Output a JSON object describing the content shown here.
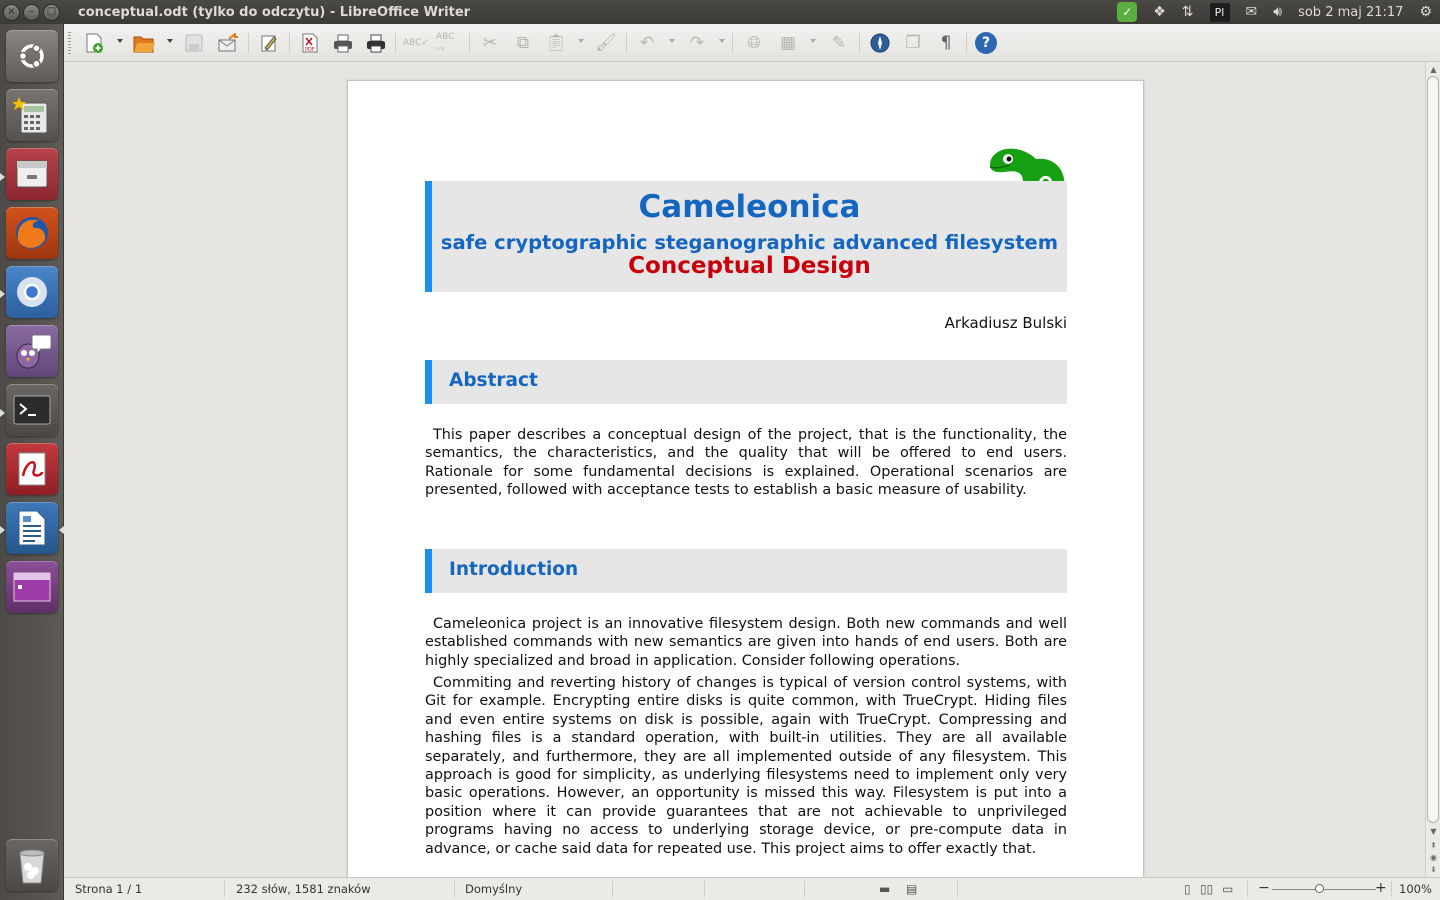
{
  "window": {
    "title": "conceptual.odt (tylko do odczytu) - LibreOffice Writer",
    "close": "×",
    "minimize": "–",
    "maximize": "□"
  },
  "indicators": {
    "keyboard_layout": "Pl",
    "clock": "sob  2 maj 21:17",
    "icons": [
      "update-icon",
      "dropbox-icon",
      "network-icon",
      "keyboard-layout-icon",
      "mail-icon",
      "volume-icon",
      "gear-icon"
    ]
  },
  "launcher": {
    "items": [
      "Ubuntu Dash",
      "Calculator",
      "Files",
      "Firefox",
      "Chromium",
      "Pidgin",
      "Terminal",
      "Document Viewer",
      "LibreOffice Writer",
      "Workspaces",
      "Trash"
    ]
  },
  "toolbar": {
    "pdf_label": "PDF",
    "pilcrow": "¶",
    "help": "?"
  },
  "document": {
    "title": "Cameleonica",
    "subtitle": "safe cryptographic steganographic advanced filesystem",
    "kind": "Conceptual Design",
    "author": "Arkadiusz Bulski",
    "sections": [
      {
        "heading": "Abstract",
        "paragraphs": [
          "This paper describes a conceptual design of the project, that is the functionality, the semantics, the characteristics, and the quality that will be offered to end users. Rationale for some fundamental decisions is explained. Operational scenarios are presented, followed with acceptance tests to establish a basic measure of usability."
        ]
      },
      {
        "heading": "Introduction",
        "paragraphs": [
          "Cameleonica project is an innovative filesystem design. Both new commands and well established commands with new semantics are given into hands of end users. Both are highly specialized and broad in application. Consider following operations.",
          "Commiting and reverting history of changes is typical of version control systems, with Git for example. Encrypting entire disks is quite common, with TrueCrypt. Hiding files and even entire systems on disk is possible, again with TrueCrypt. Compressing and hashing files is a standard operation, with built-in utilities. They are all available separately, and furthermore, they are all implemented outside of any filesystem. This approach is good for simplicity, as underlying filesystems need to implement only very basic operations. However, an opportunity is missed this way. Filesystem is put into a position where it can provide guarantees that are not achievable to unprivileged programs having no access to underlying storage device, or pre-compute data in advance, or cache said data for repeated use. This project aims to offer exactly that."
        ]
      }
    ]
  },
  "statusbar": {
    "page": "Strona 1 / 1",
    "word_count": "232 słów, 1581 znaków",
    "page_style": "Domyślny",
    "zoom": "100%",
    "zoom_minus": "−",
    "zoom_plus": "+"
  },
  "colors": {
    "heading_blue": "#1566c0",
    "accent_bar": "#1e8fe8",
    "kind_red": "#c8000b",
    "logo_green": "#16a012"
  }
}
